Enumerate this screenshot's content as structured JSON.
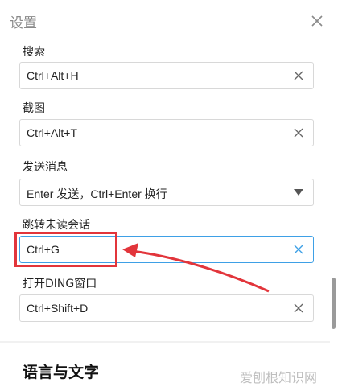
{
  "header": {
    "title": "设置"
  },
  "fields": [
    {
      "label": "搜索",
      "value": "Ctrl+Alt+H"
    },
    {
      "label": "截图",
      "value": "Ctrl+Alt+T"
    },
    {
      "label": "发送消息",
      "value": "Enter 发送，Ctrl+Enter 换行"
    },
    {
      "label": "跳转未读会话",
      "value": "Ctrl+G"
    },
    {
      "label": "打开DING窗口",
      "value": "Ctrl+Shift+D"
    }
  ],
  "next_section": {
    "title": "语言与文字"
  },
  "watermark": "爱刨根知识网",
  "colors": {
    "accent": "#3ea0e6",
    "annotation": "#e2353b"
  },
  "icons": {
    "close": "close-icon",
    "clear": "clear-icon",
    "dropdown": "dropdown-caret-icon"
  }
}
